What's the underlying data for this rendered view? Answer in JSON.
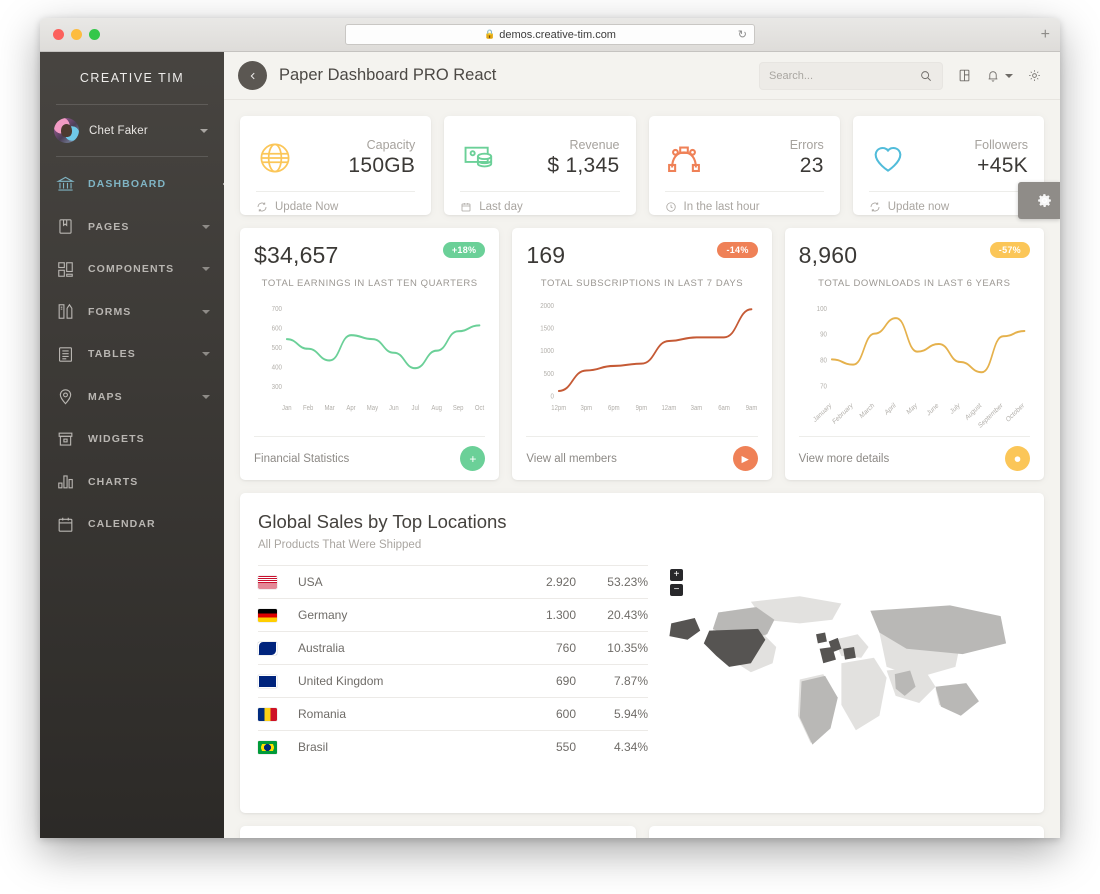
{
  "browser": {
    "url": "demos.creative-tim.com",
    "lock_icon": "lock-icon",
    "reload_icon": "reload-icon",
    "newtab_label": "+"
  },
  "sidebar": {
    "brand": "CREATIVE TIM",
    "user": {
      "name": "Chet Faker",
      "avatar": "user-avatar"
    },
    "items": [
      {
        "label": "DASHBOARD",
        "icon": "bank-icon",
        "active": true,
        "has_caret": false
      },
      {
        "label": "PAGES",
        "icon": "book-icon",
        "active": false,
        "has_caret": true
      },
      {
        "label": "COMPONENTS",
        "icon": "grid-blocks-icon",
        "active": false,
        "has_caret": true
      },
      {
        "label": "FORMS",
        "icon": "forms-icon",
        "active": false,
        "has_caret": true
      },
      {
        "label": "TABLES",
        "icon": "table-icon",
        "active": false,
        "has_caret": true
      },
      {
        "label": "MAPS",
        "icon": "pin-icon",
        "active": false,
        "has_caret": true
      },
      {
        "label": "WIDGETS",
        "icon": "widget-icon",
        "active": false,
        "has_caret": false
      },
      {
        "label": "CHARTS",
        "icon": "bar-chart-icon",
        "active": false,
        "has_caret": false
      },
      {
        "label": "CALENDAR",
        "icon": "calendar-icon",
        "active": false,
        "has_caret": false
      }
    ]
  },
  "topbar": {
    "back_icon": "chevron-left-icon",
    "title": "Paper Dashboard PRO React",
    "search_placeholder": "Search...",
    "search_value": "",
    "search_icon": "search-icon",
    "grid_icon": "grid-icon",
    "bell_icon": "bell-icon",
    "gear_icon": "gear-icon"
  },
  "settings_tab": {
    "icon": "gear-icon"
  },
  "stats": [
    {
      "label": "Capacity",
      "value": "150GB",
      "icon": "globe-icon",
      "icon_color": "#fbc658",
      "foot_icon": "refresh-icon",
      "foot": "Update Now"
    },
    {
      "label": "Revenue",
      "value": "$ 1,345",
      "icon": "money-icon",
      "icon_color": "#6bd098",
      "foot_icon": "calendar-icon",
      "foot": "Last day"
    },
    {
      "label": "Errors",
      "value": "23",
      "icon": "vector-node-icon",
      "icon_color": "#ef8157",
      "foot_icon": "clock-icon",
      "foot": "In the last hour"
    },
    {
      "label": "Followers",
      "value": "+45K",
      "icon": "heart-icon",
      "icon_color": "#51bcda",
      "foot_icon": "refresh-icon",
      "foot": "Update now"
    }
  ],
  "chart_data": [
    {
      "type": "line",
      "card_value": "$34,657",
      "badge": "+18%",
      "badge_color": "#6bd098",
      "title": "TOTAL EARNINGS IN LAST TEN QUARTERS",
      "color": "#6bd098",
      "categories": [
        "Jan",
        "Feb",
        "Mar",
        "Apr",
        "May",
        "Jun",
        "Jul",
        "Aug",
        "Sep",
        "Oct"
      ],
      "values": [
        540,
        490,
        430,
        560,
        540,
        470,
        390,
        480,
        580,
        610
      ],
      "yticks": [
        700,
        600,
        500,
        400,
        300
      ],
      "ylim": [
        250,
        740
      ],
      "xlabel": "",
      "ylabel": "",
      "grid": false,
      "legend": "none",
      "footer_label": "Financial Statistics",
      "footer_icon": "plus-icon"
    },
    {
      "type": "line",
      "card_value": "169",
      "badge": "-14%",
      "badge_color": "#ef8157",
      "title": "TOTAL SUBSCRIPTIONS IN LAST 7 DAYS",
      "color": "#c55a35",
      "categories": [
        "12pm",
        "3pm",
        "6pm",
        "9pm",
        "12am",
        "3am",
        "6am",
        "9am"
      ],
      "values": [
        100,
        550,
        650,
        700,
        1200,
        1280,
        1280,
        1900
      ],
      "yticks": [
        2000,
        1500,
        1000,
        500,
        0
      ],
      "ylim": [
        0,
        2100
      ],
      "xlabel": "",
      "ylabel": "",
      "grid": false,
      "legend": "none",
      "footer_label": "View all members",
      "footer_icon": "play-icon"
    },
    {
      "type": "line",
      "card_value": "8,960",
      "badge": "-57%",
      "badge_color": "#fbc658",
      "title": "TOTAL DOWNLOADS IN LAST 6 YEARS",
      "color": "#e5b14c",
      "categories": [
        "January",
        "February",
        "March",
        "April",
        "May",
        "June",
        "July",
        "August",
        "September",
        "October"
      ],
      "values": [
        80,
        78,
        90,
        96,
        83,
        86,
        79,
        75,
        89,
        91
      ],
      "yticks": [
        100,
        90,
        80,
        70
      ],
      "ylim": [
        66,
        103
      ],
      "xlabel": "",
      "ylabel": "",
      "grid": false,
      "legend": "none",
      "footer_label": "View more details",
      "footer_icon": "power-icon"
    }
  ],
  "sales": {
    "title": "Global Sales by Top Locations",
    "subtitle": "All Products That Were Shipped",
    "rows": [
      {
        "flag": "flag-usa",
        "country": "USA",
        "value": "2.920",
        "percent": "53.23%"
      },
      {
        "flag": "flag-germany",
        "country": "Germany",
        "value": "1.300",
        "percent": "20.43%"
      },
      {
        "flag": "flag-australia",
        "country": "Australia",
        "value": "760",
        "percent": "10.35%"
      },
      {
        "flag": "flag-uk",
        "country": "United Kingdom",
        "value": "690",
        "percent": "7.87%"
      },
      {
        "flag": "flag-romania",
        "country": "Romania",
        "value": "600",
        "percent": "5.94%"
      },
      {
        "flag": "flag-brazil",
        "country": "Brasil",
        "value": "550",
        "percent": "4.34%"
      }
    ],
    "map": {
      "zoom_in": "+",
      "zoom_out": "−"
    }
  }
}
